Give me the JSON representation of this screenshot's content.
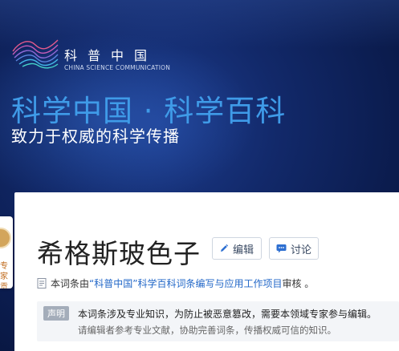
{
  "header": {
    "logo_cn": "科普中国",
    "logo_en": "CHINA SCIENCE COMMUNICATION",
    "headline": "科学中国 · 科学百科",
    "tagline": "致力于权威的科学传播"
  },
  "side_button": {
    "label": "专家贡献"
  },
  "article": {
    "title": "希格斯玻色子",
    "edit_label": "编辑",
    "discuss_label": "讨论",
    "review_prefix": "本词条由",
    "review_link": "“科普中国”科学百科词条编写与应用工作项目",
    "review_suffix": " 审核 。"
  },
  "notice": {
    "tag": "声明",
    "line1": "本词条涉及专业知识，为防止被恶意篡改，需要本领域专家参与编辑。",
    "line2": "请编辑者参考专业文献，协助完善词条，传播权威可信的知识。"
  },
  "colors": {
    "headline": "#3f9be8",
    "banner_bg": "#12296a",
    "link": "#2368c8"
  },
  "icons": [
    "science-logo-icon",
    "pencil-icon",
    "chat-icon",
    "document-icon"
  ]
}
